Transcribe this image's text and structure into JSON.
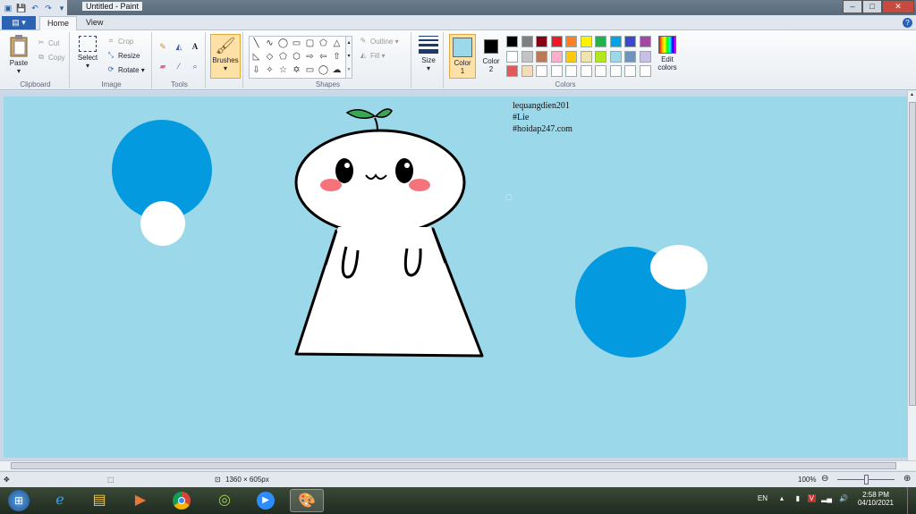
{
  "window": {
    "title": "Untitled - Paint",
    "minimize": "–",
    "maximize": "□",
    "close": "✕"
  },
  "ribbon_tabs": {
    "file": "▤ ▾",
    "home": "Home",
    "view": "View",
    "help": "?"
  },
  "clipboard": {
    "label": "Clipboard",
    "paste": "Paste",
    "cut": "Cut",
    "copy": "Copy"
  },
  "image_group": {
    "label": "Image",
    "select": "Select",
    "crop": "Crop",
    "resize": "Resize",
    "rotate": "Rotate ▾"
  },
  "tools": {
    "label": "Tools"
  },
  "brushes": {
    "label": "Brushes"
  },
  "shapes": {
    "label": "Shapes",
    "outline": "Outline ▾",
    "fill": "Fill ▾"
  },
  "size": {
    "label": "Size"
  },
  "colors": {
    "label": "Colors",
    "color1_label": "Color",
    "color1_num": "1",
    "color2_label": "Color",
    "color2_num": "2",
    "color1_value": "#9bd8e9",
    "color2_value": "#000000",
    "edit_colors": "Edit",
    "edit_colors2": "colors",
    "palette_row1": [
      "#000000",
      "#7f7f7f",
      "#880015",
      "#ed1c24",
      "#ff7f27",
      "#fff200",
      "#22b14c",
      "#00a2e8",
      "#3f48cc",
      "#a349a4"
    ],
    "palette_row2": [
      "#ffffff",
      "#c3c3c3",
      "#b97a57",
      "#ffaec9",
      "#ffc90e",
      "#efe4b0",
      "#b5e61d",
      "#99d9ea",
      "#7092be",
      "#c8bfe7"
    ],
    "palette_row3": [
      "#e05a5a",
      "#f2dcb9",
      "#ffffff",
      "#ffffff",
      "#ffffff",
      "#ffffff",
      "#ffffff",
      "#ffffff",
      "#ffffff",
      "#ffffff"
    ]
  },
  "canvas": {
    "background": "#9bd8e9",
    "text_line1": "lequangdien201",
    "text_line2": "#Lie",
    "text_line3": "#hoidap247.com"
  },
  "statusbar": {
    "dimensions": "1360 × 605px",
    "zoom": "100%"
  },
  "taskbar": {
    "language": "EN",
    "time": "2:58 PM",
    "date": "04/10/2021"
  }
}
